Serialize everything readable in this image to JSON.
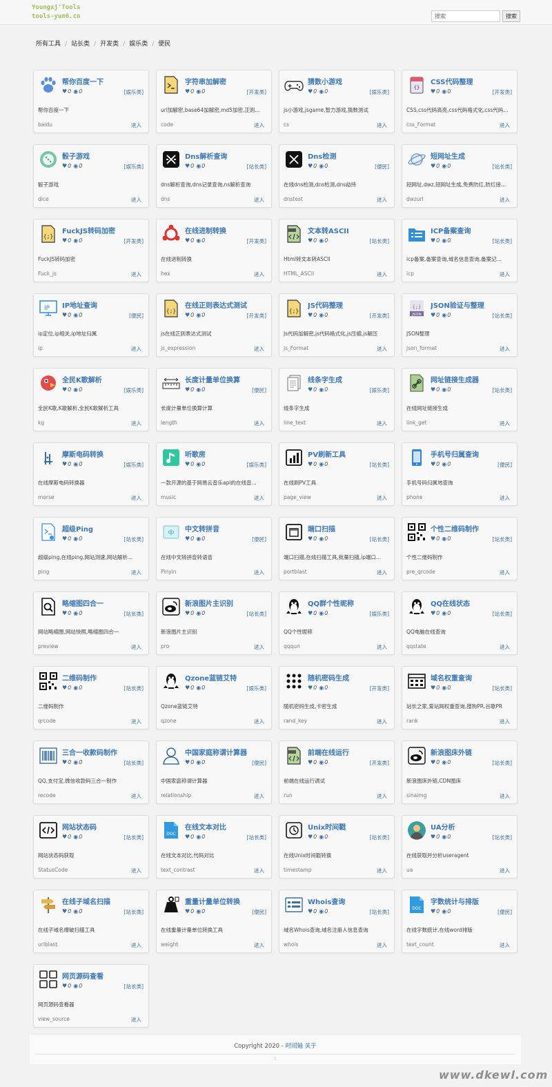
{
  "header": {
    "logo_line1": "Youngxj'Tools",
    "logo_line2": "tools-yum6.cn",
    "search_placeholder": "搜索",
    "search_button": "搜索"
  },
  "nav": [
    "所有工具",
    "站长类",
    "开发类",
    "娱乐类",
    "便民"
  ],
  "colors": {
    "title": "#3b77b7",
    "link": "#3b6ea5",
    "logo": "#9ec25a"
  },
  "tools": [
    {
      "title": "帮你百度一下",
      "cat": "[娱乐类]",
      "desc": "帮你百度一下",
      "slug": "baidu",
      "likes": "0",
      "views": "0",
      "icon": "paw-icon"
    },
    {
      "title": "字符串加解密",
      "cat": "[开发类]",
      "desc": "url加解密,base64加解密,md5加密,正则...",
      "slug": "code",
      "likes": "0",
      "views": "0",
      "icon": "terminal-file-icon"
    },
    {
      "title": "猜数小游戏",
      "cat": "[娱乐类]",
      "desc": "js小游戏,jsgame,智力游戏,猜数测试",
      "slug": "cs",
      "likes": "0",
      "views": "0",
      "icon": "gamepad-icon"
    },
    {
      "title": "CSS代码整理",
      "cat": "[开发类]",
      "desc": "CSS,css代码高亮,css代码格式化,css代码...",
      "slug": "css_Format",
      "likes": "0",
      "views": "0",
      "icon": "css-file-icon"
    },
    {
      "title": "骰子游戏",
      "cat": "[娱乐类]",
      "desc": "骰子游戏",
      "slug": "dice",
      "likes": "0",
      "views": "0",
      "icon": "dice-icon"
    },
    {
      "title": "Dns解析查询",
      "cat": "[站长类]",
      "desc": "dns解析查询,dns记录查询,ns解析查询",
      "slug": "dns",
      "likes": "0",
      "views": "0",
      "icon": "dns-icon"
    },
    {
      "title": "Dns检测",
      "cat": "[便民]",
      "desc": "在线dns检测,dns检测,dns劫持",
      "slug": "dnstest",
      "likes": "0",
      "views": "0",
      "icon": "dns-check-icon"
    },
    {
      "title": "短网址生成",
      "cat": "[站长类]",
      "desc": "短网址,dwz,短网址生成,免费防红,防红接...",
      "slug": "dwzurl",
      "likes": "0",
      "views": "0",
      "icon": "planet-icon"
    },
    {
      "title": "FuckJS转码加密",
      "cat": "[开发类]",
      "desc": "FuckJS转码加密",
      "slug": "Fuck_js",
      "likes": "0",
      "views": "0",
      "icon": "js-file-icon"
    },
    {
      "title": "在线进制转换",
      "cat": "[开发类]",
      "desc": "在线进制转换",
      "slug": "hex",
      "likes": "0",
      "views": "0",
      "icon": "hex-icon"
    },
    {
      "title": "文本转ASCII",
      "cat": "[站长类]",
      "desc": "Html转文本转ASCII",
      "slug": "HTML_ASCII",
      "likes": "0",
      "views": "0",
      "icon": "html-file-icon"
    },
    {
      "title": "ICP备案查询",
      "cat": "[站长类]",
      "desc": "icp备案,备案查询,域名信息查询,备案记...",
      "slug": "icp",
      "likes": "0",
      "views": "0",
      "icon": "folder-list-icon"
    },
    {
      "title": "IP地址查询",
      "cat": "[便民]",
      "desc": "ip定位,ip相关,ip地址归属",
      "slug": "ip",
      "likes": "0",
      "views": "0",
      "icon": "ip-monitor-icon"
    },
    {
      "title": "在线正则表达式测试",
      "cat": "[开发类]",
      "desc": "js在线正则表达式测试",
      "slug": "js_expression",
      "likes": "0",
      "views": "0",
      "icon": "js-file-icon"
    },
    {
      "title": "JS代码整理",
      "cat": "[开发类]",
      "desc": "Js代码加解密,js代码格式化,js压缩,js解压",
      "slug": "js_Format",
      "likes": "0",
      "views": "0",
      "icon": "js-file-icon"
    },
    {
      "title": "JSON验证与整理",
      "cat": "[站长类]",
      "desc": "JSON整理",
      "slug": "json_format",
      "likes": "0",
      "views": "0",
      "icon": "json-file-icon"
    },
    {
      "title": "全民K歌解析",
      "cat": "[娱乐类]",
      "desc": "全民K歌,K歌解析,全民K歌解析工具",
      "slug": "kg",
      "likes": "0",
      "views": "0",
      "icon": "bird-icon"
    },
    {
      "title": "长度计量单位换算",
      "cat": "[便民]",
      "desc": "长度计量单位换算计算",
      "slug": "length",
      "likes": "0",
      "views": "0",
      "icon": "ruler-icon"
    },
    {
      "title": "线条字生成",
      "cat": "[娱乐类]",
      "desc": "线条字生成",
      "slug": "line_text",
      "likes": "0",
      "views": "0",
      "icon": "pages-icon"
    },
    {
      "title": "网址链接生成器",
      "cat": "[站长类]",
      "desc": "在线网址链接生成",
      "slug": "link_get",
      "likes": "0",
      "views": "0",
      "icon": "link-file-icon"
    },
    {
      "title": "摩斯电码转换",
      "cat": "[娱乐类]",
      "desc": "在线摩斯电码转换器",
      "slug": "morse",
      "likes": "0",
      "views": "0",
      "icon": "morse-icon"
    },
    {
      "title": "听歌房",
      "cat": "[娱乐类]",
      "desc": "一款开源的基于网易云音乐api的在线音...",
      "slug": "music",
      "likes": "0",
      "views": "0",
      "icon": "music-icon"
    },
    {
      "title": "PV刷新工具",
      "cat": "[站长类]",
      "desc": "在线刷PV工具",
      "slug": "page_view",
      "likes": "0",
      "views": "0",
      "icon": "bar-chart-icon"
    },
    {
      "title": "手机号归属查询",
      "cat": "[便民]",
      "desc": "手机号码归属地查询",
      "slug": "phone",
      "likes": "0",
      "views": "0",
      "icon": "phone-icon"
    },
    {
      "title": "超级Ping",
      "cat": "[站长类]",
      "desc": "超级ping,在线ping,网站测速,网站解析...",
      "slug": "ping",
      "likes": "0",
      "views": "0",
      "icon": "ping-file-icon"
    },
    {
      "title": "中文转拼音",
      "cat": "[便民]",
      "desc": "在线中文转拼音转语音",
      "slug": "Pinyin",
      "likes": "0",
      "views": "0",
      "icon": "pinyin-icon"
    },
    {
      "title": "端口扫描",
      "cat": "[站长类]",
      "desc": "端口扫描,在线扫描工具,批量扫描,ip端口...",
      "slug": "portblast",
      "likes": "0",
      "views": "0",
      "icon": "port-icon"
    },
    {
      "title": "个性二维码制作",
      "cat": "[站长类]",
      "desc": "个性二维码制作",
      "slug": "pre_qrcode",
      "likes": "0",
      "views": "0",
      "icon": "qrcode-icon"
    },
    {
      "title": "略缩图四合一",
      "cat": "[站长类]",
      "desc": "网站略缩图,网站快照,略缩图四合一",
      "slug": "preview",
      "likes": "0",
      "views": "0",
      "icon": "magnifier-icon"
    },
    {
      "title": "新浪图片主识别",
      "cat": "[站长类]",
      "desc": "新浪图片主识别",
      "slug": "pro",
      "likes": "0",
      "views": "0",
      "icon": "weibo-icon"
    },
    {
      "title": "QQ群个性昵称",
      "cat": "[娱乐类]",
      "desc": "QQ个性昵称",
      "slug": "qqqun",
      "likes": "0",
      "views": "0",
      "icon": "qq-penguin-icon"
    },
    {
      "title": "QQ在线状态",
      "cat": "[站长类]",
      "desc": "QQ电脑在线查询",
      "slug": "qqstate",
      "likes": "0",
      "views": "0",
      "icon": "qq-penguin-icon"
    },
    {
      "title": "二维码制作",
      "cat": "[站长类]",
      "desc": "二维码制作",
      "slug": "qrcode",
      "likes": "0",
      "views": "0",
      "icon": "qrcode-icon"
    },
    {
      "title": "Qzone蓝链艾特",
      "cat": "[娱乐类]",
      "desc": "Qzone蓝链艾特",
      "slug": "qzone",
      "likes": "0",
      "views": "0",
      "icon": "qq-penguin-icon"
    },
    {
      "title": "随机密码生成",
      "cat": "[开发类]",
      "desc": "随机密码生成,卡密生成",
      "slug": "rand_key",
      "likes": "0",
      "views": "0",
      "icon": "dots-grid-icon"
    },
    {
      "title": "域名权重查询",
      "cat": "[站长类]",
      "desc": "站长之家,爱站网权重查询,搜狗PR,谷歌PR",
      "slug": "rank",
      "likes": "0",
      "views": "0",
      "icon": "rank-icon"
    },
    {
      "title": "三合一收款码制作",
      "cat": "[站长类]",
      "desc": "QQ,支付宝,微信收款码三合一制作",
      "slug": "recode",
      "likes": "0",
      "views": "0",
      "icon": "barcode-icon"
    },
    {
      "title": "中国家庭称谓计算器",
      "cat": "[便民]",
      "desc": "中国家庭称谓计算器",
      "slug": "relationship",
      "likes": "0",
      "views": "0",
      "icon": "person-icon"
    },
    {
      "title": "前端在线运行",
      "cat": "[开发类]",
      "desc": "前端在线运行调试",
      "slug": "run",
      "likes": "0",
      "views": "0",
      "icon": "html-file-icon"
    },
    {
      "title": "新浪图床外链",
      "cat": "[站长类]",
      "desc": "新浪图床外链,CDN图床",
      "slug": "sinaimg",
      "likes": "0",
      "views": "0",
      "icon": "weibo-icon"
    },
    {
      "title": "网站状态码",
      "cat": "[站长类]",
      "desc": "网站状态码获取",
      "slug": "StatusCode",
      "likes": "0",
      "views": "0",
      "icon": "code-window-icon"
    },
    {
      "title": "在线文本对比",
      "cat": "[站长类]",
      "desc": "在线文本对比,代码对比",
      "slug": "text_contrast",
      "likes": "0",
      "views": "0",
      "icon": "doc-file-icon"
    },
    {
      "title": "Unix时间戳",
      "cat": "[站长类]",
      "desc": "在线Unix时间戳转换",
      "slug": "timestamp",
      "likes": "0",
      "views": "0",
      "icon": "clock-icon"
    },
    {
      "title": "UA分析",
      "cat": "[站长类]",
      "desc": "在线获取并分析useragent",
      "slug": "ua",
      "likes": "0",
      "views": "0",
      "icon": "avatar-icon"
    },
    {
      "title": "在线子域名扫描",
      "cat": "[站长类]",
      "desc": "在线子域名爆破扫描工具",
      "slug": "urlblast",
      "likes": "0",
      "views": "0",
      "icon": "signpost-icon"
    },
    {
      "title": "重量计量单位转换",
      "cat": "[便民]",
      "desc": "在线重量计量单位转换工具",
      "slug": "weight",
      "likes": "0",
      "views": "0",
      "icon": "weight-icon"
    },
    {
      "title": "Whois查询",
      "cat": "[站长类]",
      "desc": "域名Whois查询,域名注册人信息查询",
      "slug": "whois",
      "likes": "0",
      "views": "0",
      "icon": "list-window-icon"
    },
    {
      "title": "字数统计与排版",
      "cat": "[便民]",
      "desc": "在线字数统计,在线word排版",
      "slug": "text_count",
      "likes": "0",
      "views": "0",
      "icon": "doc-file-icon"
    },
    {
      "title": "网页源码查看",
      "cat": "[站长类]",
      "desc": "网页源码查看器",
      "slug": "view_source",
      "likes": "0",
      "views": "0",
      "icon": "squares-icon"
    }
  ],
  "card_enter_label": "进入",
  "footer": {
    "copyright": "Copyright 2020 - ",
    "link1": "时间轴",
    "link2": "关于",
    "colon": ":"
  },
  "watermark": "www.dkewl.com"
}
